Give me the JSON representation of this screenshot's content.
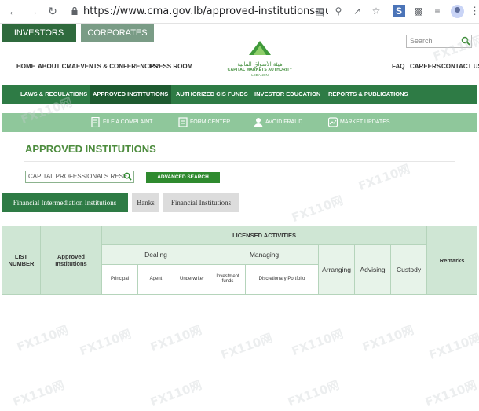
{
  "browser": {
    "url": "https://www.cma.gov.lb/approved-institutions-quick-s...",
    "icons": [
      "back-icon",
      "forward-icon",
      "reload-icon",
      "lock-icon",
      "translate-icon",
      "zoom-icon",
      "share-icon",
      "star-icon",
      "extension-s-icon",
      "puzzle-icon",
      "reading-list-icon",
      "profile-icon",
      "menu-icon"
    ]
  },
  "top_tabs": [
    "INVESTORS",
    "CORPORATES"
  ],
  "search": {
    "placeholder": "Search"
  },
  "left_menu": [
    "HOME",
    "ABOUT CMA",
    "EVENTS & CONFERENCES",
    "PRESS ROOM"
  ],
  "right_menu": [
    "FAQ",
    "CAREERS",
    "CONTACT US"
  ],
  "logo": {
    "arabic": "هيئة الأسواق المالية",
    "english": "CAPITAL MARKETS AUTHORITY",
    "sub": "LEBANON"
  },
  "main_nav": [
    "LAWS & REGULATIONS",
    "APPROVED INSTITUTIONS",
    "AUTHORIZED CIS FUNDS",
    "INVESTOR EDUCATION",
    "REPORTS & PUBLICATIONS"
  ],
  "quick_links": [
    "FILE A COMPLAINT",
    "FORM CENTER",
    "AVOID FRAUD",
    "MARKET UPDATES"
  ],
  "page_title": "APPROVED INSTITUTIONS",
  "filter": {
    "value": "CAPITAL PROFESSIONALS RESE",
    "button": "ADVANCED SEARCH"
  },
  "category_tabs": [
    "Financial Intermediation Institutions",
    "Banks",
    "Financial Institutions"
  ],
  "table": {
    "licensed_activities": "LICENSED ACTIVITIES",
    "list_number": "LIST NUMBER",
    "approved_institutions": "Approved Institutions",
    "dealing": "Dealing",
    "managing": "Managing",
    "principal": "Principal",
    "agent": "Agent",
    "underwriter": "Underwriter",
    "investment_funds": "Investment funds",
    "discretionary_portfolio": "Discretionary Portfolio",
    "arranging": "Arranging",
    "advising": "Advising",
    "custody": "Custody",
    "remarks": "Remarks"
  },
  "watermark": "FX110网",
  "colors": {
    "dark_green": "#2e7b45",
    "light_green": "#8fc79b",
    "title_green": "#4d8c3e"
  }
}
